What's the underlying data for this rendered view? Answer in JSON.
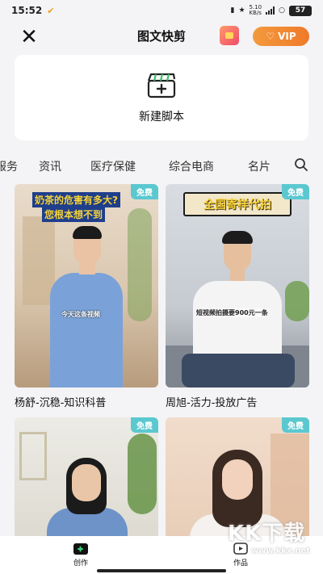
{
  "statusbar": {
    "time": "15:52",
    "network_speed": "5.10\nKB/s",
    "battery": "57"
  },
  "header": {
    "title": "图文快剪",
    "vip_label": "VIP"
  },
  "new_script": {
    "label": "新建脚本"
  },
  "tabs": [
    "服务",
    "资讯",
    "医疗保健",
    "综合电商",
    "名片"
  ],
  "cards": [
    {
      "title": "杨舒-沉稳-知识科普",
      "badge": "免费",
      "overlay_top": "奶茶的危害有多大?",
      "overlay_top2": "您根本想不到",
      "caption": "今天这条视频"
    },
    {
      "title": "周旭-活力-投放广告",
      "badge": "免费",
      "overlay_top": "全国寄样代拍",
      "caption": "短视频拍摄要900元一条"
    },
    {
      "title": "",
      "badge": "免费"
    },
    {
      "title": "",
      "badge": "免费"
    }
  ],
  "bottom_nav": {
    "create": "创作",
    "works": "作品"
  },
  "watermark": {
    "big": "KK下载",
    "small": "www.kkx.net"
  },
  "colors": {
    "vip": "#f07a2a",
    "badge": "#5bc8d0",
    "background": "#f4f4f6"
  }
}
